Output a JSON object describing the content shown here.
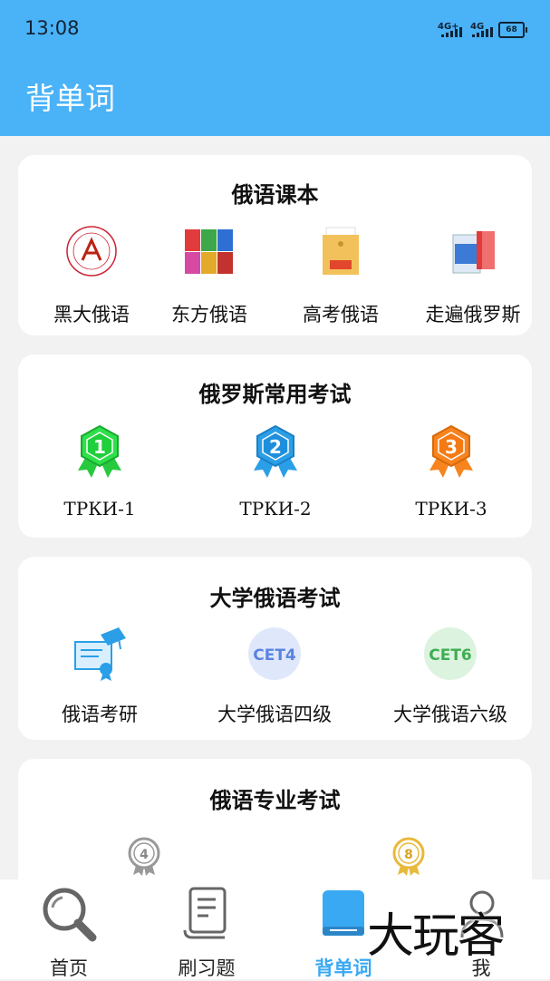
{
  "status": {
    "time": "13:08",
    "signal1": "4G+",
    "signal2": "4G",
    "battery": "68"
  },
  "header": {
    "title": "背单词"
  },
  "sections": {
    "textbooks": {
      "title": "俄语课本",
      "items": [
        {
          "label": "黑大俄语"
        },
        {
          "label": "东方俄语"
        },
        {
          "label": "高考俄语"
        },
        {
          "label": "走遍俄罗斯"
        }
      ]
    },
    "russian_exams": {
      "title": "俄罗斯常用考试",
      "items": [
        {
          "label": "ТРКИ-1",
          "badge": "1",
          "color": "#2ee04a"
        },
        {
          "label": "ТРКИ-2",
          "badge": "2",
          "color": "#2a9fe8"
        },
        {
          "label": "ТРКИ-3",
          "badge": "3",
          "color": "#f7841e"
        }
      ]
    },
    "college_exams": {
      "title": "大学俄语考试",
      "items": [
        {
          "label": "俄语考研"
        },
        {
          "label": "大学俄语四级",
          "badge": "CET4"
        },
        {
          "label": "大学俄语六级",
          "badge": "CET6"
        }
      ]
    },
    "major_exams": {
      "title": "俄语专业考试",
      "items": [
        {
          "badge": "4"
        },
        {
          "badge": "8"
        }
      ]
    }
  },
  "tabs": [
    {
      "label": "首页"
    },
    {
      "label": "刷习题"
    },
    {
      "label": "背单词"
    },
    {
      "label": "我"
    }
  ],
  "watermark": "大玩客"
}
